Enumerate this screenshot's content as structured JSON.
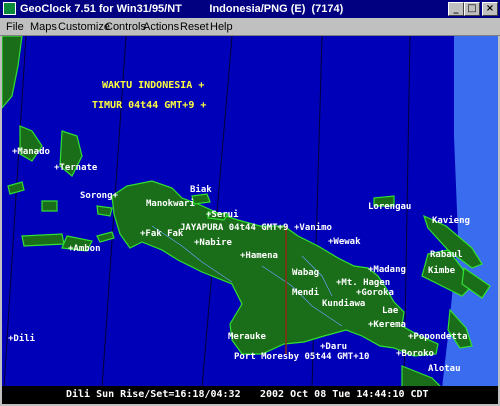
{
  "window": {
    "title": "GeoClock 7.51 for Win31/95/NT         Indonesia/PNG (E)  (7174)",
    "minimize_glyph": "_",
    "maximize_glyph": "□",
    "close_glyph": "×"
  },
  "menu": [
    "File",
    "Maps",
    "Customize",
    "Controls",
    "Actions",
    "Reset",
    "Help"
  ],
  "zone_info": {
    "line1": "WAKTU INDONESIA +",
    "line2": "TIMUR 04t44 GMT+9 +"
  },
  "places": {
    "manado": "+Manado",
    "ternate": "+Ternate",
    "sorong": "Sorong+",
    "biak": "Biak",
    "manokwari": "Manokwari",
    "serui": "+Serui",
    "fakfak": "+Fak Fak",
    "jayapura": "JAYAPURA 04t44 GMT+9",
    "vanimo": "+Vanimo",
    "lorengau": "Lorengau",
    "kavieng": "Kavieng",
    "ambon": "+Ambon",
    "nabire": "+Nabire",
    "wewak": "+Wewak",
    "rabaul": "Rabaul",
    "hamena": "+Hamena",
    "wabag": "Wabag",
    "madang": "+Madang",
    "mthagen": "+Mt. Hagen",
    "kimbe": "Kimbe",
    "mendi": "Mendi",
    "goroka": "+Goroka",
    "kundiawa": "Kundiawa",
    "lae": "Lae",
    "dili": "+Dili",
    "merauke": "Merauke",
    "kerema": "+Kerema",
    "popondetta": "+Popondetta",
    "daru": "+Daru",
    "portmoresby": "Port Moresby 05t44 GMT+10",
    "boroko": "+Boroko",
    "alotau": "Alotau"
  },
  "status": {
    "sun": "Dili Sun Rise/Set=16:18/04:32",
    "datetime": "2002 Oct 08 Tue 14:44:10 CDT"
  },
  "colors": {
    "ocean_night": "#0000b8",
    "ocean_day": "#3a6cf0",
    "land": "#1a6e1a",
    "coast": "#30e030",
    "zone_label": "#ffff40"
  }
}
